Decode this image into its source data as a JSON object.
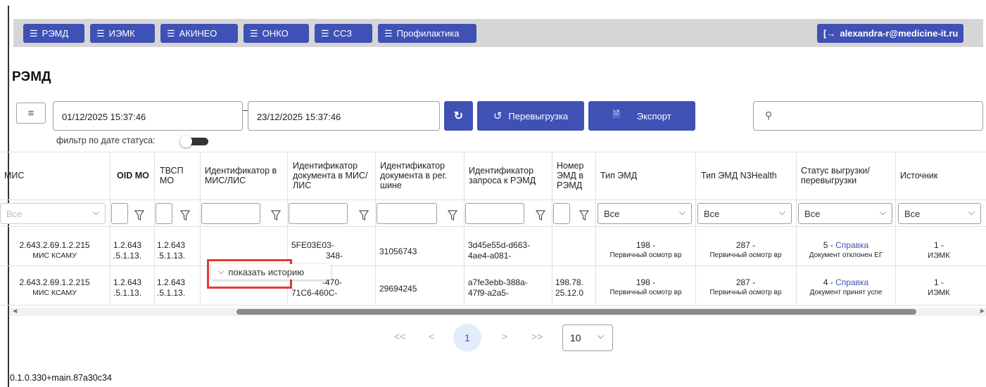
{
  "nav": {
    "items": [
      {
        "label": "РЭМД"
      },
      {
        "label": "ИЭМК"
      },
      {
        "label": "АКИНЕО"
      },
      {
        "label": "ОНКО"
      },
      {
        "label": "ССЗ"
      },
      {
        "label": "Профилактика"
      }
    ],
    "user": "alexandra-r@medicine-it.ru",
    "accent": "#3f51b5"
  },
  "page": {
    "title": "РЭМД"
  },
  "filters": {
    "date_from": "01/12/2025 15:37:46",
    "date_to": "23/12/2025 15:37:46",
    "reupload_label": "Перевыгрузка",
    "export_label": "Экспорт",
    "status_date_filter_label": "фильтр по дате статуса:",
    "status_date_filter_on": false
  },
  "table": {
    "headers": {
      "mis": "МИС",
      "oid": "OID МО",
      "tvsp": "ТВСП МО",
      "id_mis": "Идентификатор в МИС/ЛИС",
      "doc_id_mis": "Идентификатор документа в МИС/ЛИС",
      "doc_id_bus": "Идентификатор документа в рег. шине",
      "req_id": "Идентификатор запроса к РЭМД",
      "emd_num": "Номер ЭМД в РЭМД",
      "emd_type": "Тип ЭМД",
      "emd_type_n3": "Тип ЭМД N3Health",
      "status": "Статус выгрузки/ перевыгрузки",
      "source": "Источник"
    },
    "filter_all": "Все",
    "rows": [
      {
        "mis_1": "2.643.2.69.1.2.215",
        "mis_2": "МИС КСАМУ",
        "oid_1": "1.2.643",
        "oid_2": ".5.1.13.",
        "tvsp_1": "1.2.643",
        "tvsp_2": ".5.1.13.",
        "doc_mis_1": "5FE03E03-",
        "doc_mis_2": "348-",
        "doc_bus": "31056743",
        "req_1": "3d45e55d-d663-",
        "req_2": "4ae4-a081-",
        "emd_num_1": "",
        "emd_num_2": "",
        "type_1": "198 -",
        "type_2": "Первичный осмотр вр",
        "n3_1": "287 -",
        "n3_2": "Первичный осмотр вр",
        "status_num": "5 -",
        "status_link": "Справка",
        "status_text": "Документ отклонен ЕГ",
        "src_1": "1 -",
        "src_2": "ИЭМК"
      },
      {
        "mis_1": "2.643.2.69.1.2.215",
        "mis_2": "МИС КСАМУ",
        "oid_1": "1.2.643",
        "oid_2": ".5.1.13.",
        "tvsp_1": "1.2.643",
        "tvsp_2": ".5.1.13.",
        "doc_mis_1": "-470-",
        "doc_mis_2": "71C6-460C-",
        "doc_bus": "29694245",
        "req_1": "a7fe3ebb-388a-",
        "req_2": "47f9-a2a5-",
        "emd_num_1": "198.78.",
        "emd_num_2": "25.12.0",
        "type_1": "198 -",
        "type_2": "Первичный осмотр вр",
        "n3_1": "287 -",
        "n3_2": "Первичный осмотр вр",
        "status_num": "4 -",
        "status_link": "Справка",
        "status_text": "Документ принят успе",
        "src_1": "1 -",
        "src_2": "ИЭМК"
      }
    ],
    "history_popup": "показать историю"
  },
  "pagination": {
    "first": "<<",
    "prev": "<",
    "current": "1",
    "next": ">",
    "last": ">>",
    "page_size": "10"
  },
  "footer": {
    "version": "0.1.0.330+main.87a30c34"
  }
}
